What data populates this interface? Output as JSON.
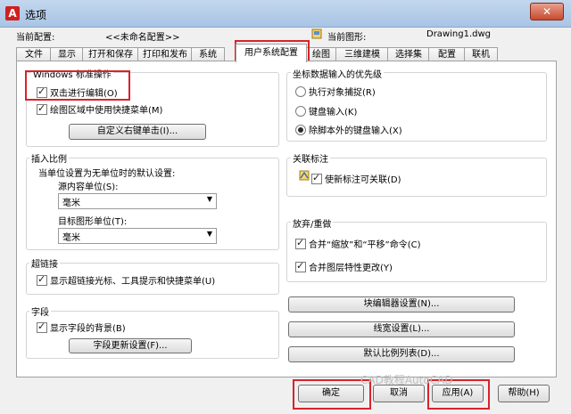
{
  "window": {
    "title": "选项",
    "app_icon": "A",
    "close": "✕"
  },
  "header": {
    "profile_label": "当前配置:",
    "profile_value": "<<未命名配置>>",
    "drawing_label": "当前图形:",
    "drawing_value": "Drawing1.dwg"
  },
  "tabs": [
    "文件",
    "显示",
    "打开和保存",
    "打印和发布",
    "系统",
    "用户系统配置",
    "绘图",
    "三维建模",
    "选择集",
    "配置",
    "联机"
  ],
  "active_tab": "用户系统配置",
  "windows_ops": {
    "title": "Windows 标准操作",
    "double_click_edit": "双击进行编辑(O)",
    "shortcut_menus": "绘图区域中使用快捷菜单(M)",
    "customize_right_click": "自定义右键单击(I)..."
  },
  "insertion_scale": {
    "title": "插入比例",
    "desc": "当单位设置为无单位时的默认设置:",
    "source_label": "源内容单位(S):",
    "source_value": "毫米",
    "target_label": "目标图形单位(T):",
    "target_value": "毫米"
  },
  "hyperlink": {
    "title": "超链接",
    "option": "显示超链接光标、工具提示和快捷菜单(U)"
  },
  "fields": {
    "title": "字段",
    "option": "显示字段的背景(B)",
    "update_button": "字段更新设置(F)..."
  },
  "coord_priority": {
    "title": "坐标数据输入的优先级",
    "opt1": "执行对象捕捉(R)",
    "opt2": "键盘输入(K)",
    "opt3": "除脚本外的键盘输入(X)"
  },
  "assoc_dim": {
    "title": "关联标注",
    "option": "使新标注可关联(D)"
  },
  "undo_redo": {
    "title": "放弃/重做",
    "opt1": "合并“缩放”和“平移”命令(C)",
    "opt2": "合并图层特性更改(Y)"
  },
  "right_buttons": {
    "block_editor": "块编辑器设置(N)...",
    "lineweight": "线宽设置(L)...",
    "scale_list": "默认比例列表(D)..."
  },
  "footer": {
    "ok": "确定",
    "cancel": "取消",
    "apply": "应用(A)",
    "help": "帮助(H)",
    "watermark": "CAD教程AutoCAD"
  }
}
